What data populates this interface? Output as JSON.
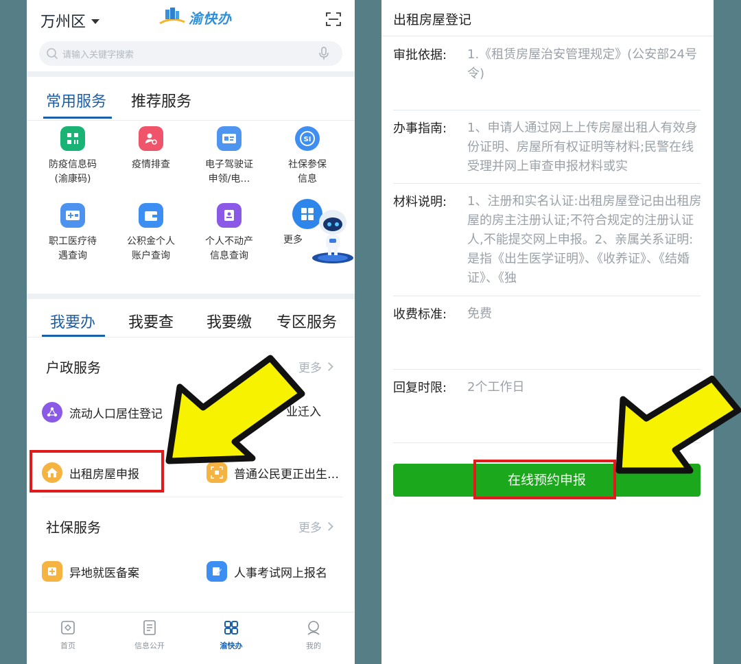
{
  "left": {
    "region": "万州区",
    "logo_text": "渝快办",
    "search_placeholder": "请输入关键字搜索",
    "tabs_top": [
      "常用服务",
      "推荐服务"
    ],
    "grid": [
      {
        "label": "防疫信息码\n(渝康码)",
        "icon": "qr-code-icon",
        "color": "#19b376"
      },
      {
        "label": "疫情排查",
        "icon": "person-search-icon",
        "color": "#f0546a"
      },
      {
        "label": "电子驾驶证\n申领/电…",
        "icon": "license-card-icon",
        "color": "#4e95f0"
      },
      {
        "label": "社保参保\n信息",
        "icon": "social-security-icon",
        "color": "#3f8ef0"
      },
      {
        "label": "职工医疗待\n遇查询",
        "icon": "medical-card-icon",
        "color": "#4d92ef"
      },
      {
        "label": "公积金个人\n账户查询",
        "icon": "wallet-icon",
        "color": "#3d8ef2"
      },
      {
        "label": "个人不动产\n信息查询",
        "icon": "property-icon",
        "color": "#8a5ae6"
      },
      {
        "label": "更多",
        "icon": "more-apps-icon",
        "color": "#2e86ea"
      }
    ],
    "tabs_bottom": [
      "我要办",
      "我要查",
      "我要缴",
      "专区服务"
    ],
    "section1": {
      "title": "户政服务",
      "more": "更多",
      "items": [
        "流动人口居住登记",
        "业迁入",
        "出租房屋申报",
        "普通公民更正出生…"
      ]
    },
    "section2": {
      "title": "社保服务",
      "more": "更多",
      "items": [
        "异地就医备案",
        "人事考试网上报名"
      ]
    },
    "nav": [
      "首页",
      "信息公开",
      "渝快办",
      "我的"
    ]
  },
  "right": {
    "title": "出租房屋登记",
    "rows": [
      {
        "label": "审批依据:",
        "value": "1.《租赁房屋治安管理规定》(公安部24号令)"
      },
      {
        "label": "办事指南:",
        "value": "1、申请人通过网上上传房屋出租人有效身份证明、房屋所有权证明等材料;民警在线受理并网上审查申报材料或实"
      },
      {
        "label": "材料说明:",
        "value": "1、注册和实名认证:出租房屋登记由出租房屋的房主注册认证;不符合规定的注册认证人,不能提交网上申报。2、亲属关系证明:是指《出生医学证明》、《收养证》、《结婚证》、《独"
      },
      {
        "label": "收费标准:",
        "value": "免费"
      },
      {
        "label": "回复时限:",
        "value": "2个工作日"
      }
    ],
    "button": "在线预约申报"
  },
  "colors": {
    "primary_blue": "#1a5fa8",
    "highlight_red": "#e01b1b",
    "button_green": "#1ca81c",
    "arrow_yellow": "#f7f200",
    "background": "#567e87"
  }
}
